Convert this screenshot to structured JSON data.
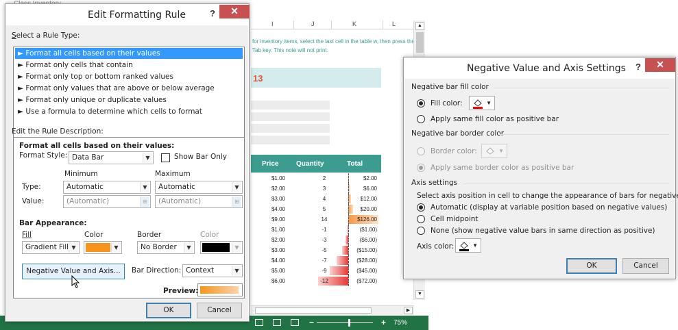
{
  "excel": {
    "top_text": "Class Inventory",
    "columns": [
      "I",
      "J",
      "K",
      "L"
    ],
    "note": "for inventory items, select the last cell in the table w, then press the Tab key. This note will not print.",
    "title_fragment": "13",
    "table_headers": {
      "price": "Price",
      "quantity": "Quantity",
      "total": "Total"
    },
    "rows": [
      {
        "price": "$1.00",
        "qty": "2",
        "total": "$2.00",
        "value": 2
      },
      {
        "price": "$2.00",
        "qty": "3",
        "total": "$6.00",
        "value": 6
      },
      {
        "price": "$3.00",
        "qty": "4",
        "total": "$12.00",
        "value": 12
      },
      {
        "price": "$4.00",
        "qty": "5",
        "total": "$20.00",
        "value": 20
      },
      {
        "price": "$9.00",
        "qty": "14",
        "total": "$126.00",
        "value": 126
      },
      {
        "price": "$1.00",
        "qty": "-1",
        "total": "($1.00)",
        "value": -1
      },
      {
        "price": "$2.00",
        "qty": "-3",
        "total": "($6.00)",
        "value": -6
      },
      {
        "price": "$3.00",
        "qty": "-5",
        "total": "($15.00)",
        "value": -15
      },
      {
        "price": "$4.00",
        "qty": "-7",
        "total": "($28.00)",
        "value": -28
      },
      {
        "price": "$5.00",
        "qty": "-9",
        "total": "($45.00)",
        "value": -45
      },
      {
        "price": "$6.00",
        "qty": "-12",
        "total": "($72.00)",
        "value": -72
      }
    ],
    "zoom": "75%",
    "colors": {
      "header": "#3c9c8f",
      "status": "#217346",
      "positive_bar": "#f79646",
      "negative_bar": "#e53935"
    }
  },
  "edit_rule": {
    "title": "Edit Formatting Rule",
    "help": "?",
    "close": "✕",
    "select_type_label": "Select a Rule Type:",
    "rule_types": [
      "► Format all cells based on their values",
      "► Format only cells that contain",
      "► Format only top or bottom ranked values",
      "► Format only values that are above or below average",
      "► Format only unique or duplicate values",
      "► Use a formula to determine which cells to format"
    ],
    "edit_desc_label": "Edit the Rule Description:",
    "desc_heading": "Format all cells based on their values:",
    "format_style_label": "Format Style:",
    "format_style_value": "Data Bar",
    "show_bar_only": "Show Bar Only",
    "minimum": "Minimum",
    "maximum": "Maximum",
    "type_label": "Type:",
    "value_label": "Value:",
    "min_type": "Automatic",
    "max_type": "Automatic",
    "min_value": "(Automatic)",
    "max_value": "(Automatic)",
    "bar_appearance": "Bar Appearance:",
    "fill_label": "Fill",
    "color_label": "Color",
    "border_label": "Border",
    "color_label2": "Color",
    "fill_value": "Gradient Fill",
    "border_value": "No Border",
    "fill_color": "#f7941d",
    "neg_button": "Negative Value and Axis...",
    "bar_direction_label": "Bar Direction:",
    "bar_direction_value": "Context",
    "preview_label": "Preview:",
    "ok": "OK",
    "cancel": "Cancel"
  },
  "neg_dialog": {
    "title": "Negative Value and Axis Settings",
    "help": "?",
    "close": "✕",
    "fill_group": "Negative bar fill color",
    "fill_color_opt": "Fill color:",
    "apply_same_fill": "Apply same fill color as positive bar",
    "border_group": "Negative bar border color",
    "border_color_opt": "Border color:",
    "apply_same_border": "Apply same border color as positive bar",
    "axis_group": "Axis settings",
    "axis_desc": "Select axis position in cell to change the appearance of bars for negative values",
    "axis_auto": "Automatic (display at variable position based on negative values)",
    "axis_mid": "Cell midpoint",
    "axis_none": "None (show negative value bars in same direction as positive)",
    "axis_color": "Axis color:",
    "ok": "OK",
    "cancel": "Cancel",
    "neg_fill_color": "#ff0000",
    "axis_color_value": "#000000"
  }
}
